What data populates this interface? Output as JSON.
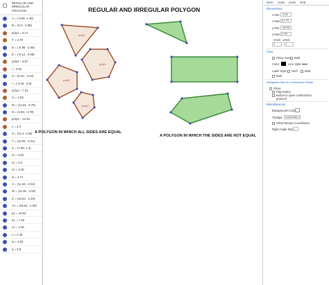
{
  "algebra": {
    "header": "REGULAR AND IRREGULAR POLYGON",
    "rows": [
      {
        "text": "A = (-3.96, 1.46)",
        "color": "#3c50b4"
      },
      {
        "text": "B = (0.4, -1.98)",
        "color": "#3c50b4"
      },
      {
        "text": "poly1 = 8.17",
        "color": "#b06030"
      },
      {
        "text": "F = 3.79",
        "color": "#b06030"
      },
      {
        "text": "D = (-0.98, -2.68)",
        "color": "#3c50b4"
      },
      {
        "text": "E = (-0.12, -2.98)",
        "color": "#3c50b4"
      },
      {
        "text": "poly2 = 8.87",
        "color": "#b06030"
      },
      {
        "text": "i = 2.82",
        "color": "#b06030"
      },
      {
        "text": "H = (0.32, -4.12)",
        "color": "#3c50b4"
      },
      {
        "text": "I = (-0.19, -5.5)",
        "color": "#3c50b4"
      },
      {
        "text": "poly3 = 7.51",
        "color": "#b06030"
      },
      {
        "text": "m = 2.06",
        "color": "#b06030"
      },
      {
        "text": "M = (11.94, -3.79)",
        "color": "#3c50b4"
      },
      {
        "text": "N = (4.08, -4.78)",
        "color": "#3c50b4"
      },
      {
        "text": "poly4 = 13.26",
        "color": "#b06030"
      },
      {
        "text": "s = 2.3",
        "color": "#b06030"
      },
      {
        "text": "S = (11.4, 1.86)",
        "color": "#3c50b4"
      },
      {
        "text": "T = (12.84, -0.44)",
        "color": "#3c50b4"
      },
      {
        "text": "U = (7.98, 1.4)",
        "color": "#3c50b4"
      },
      {
        "text": "t1 = 4.26",
        "color": "#3c50b4"
      },
      {
        "text": "s1 = 5.2",
        "color": "#3c50b4"
      },
      {
        "text": "v1 = 3.45",
        "color": "#3c50b4"
      },
      {
        "text": "w = 2.71",
        "color": "#3c50b4"
      },
      {
        "text": "V = (11.26, -2.04)",
        "color": "#3c50b4"
      },
      {
        "text": "W = (11.36, -4.52)",
        "color": "#3c50b4"
      },
      {
        "text": "Z = (18.54, -4.34)",
        "color": "#3c50b4"
      },
      {
        "text": "A1 = (18.54, -1.98)",
        "color": "#3c50b4"
      },
      {
        "text": "p1 = 19.64",
        "color": "#3c50b4"
      },
      {
        "text": "a1 = 7.26",
        "color": "#3c50b4"
      },
      {
        "text": "x1 = 2.36",
        "color": "#3c50b4"
      },
      {
        "text": "v = 2.48",
        "color": "#3c50b4"
      },
      {
        "text": "w = 2.82",
        "color": "#3c50b4"
      },
      {
        "text": "q = 5.8",
        "color": "#3c50b4"
      }
    ]
  },
  "graphics": {
    "title": "REGULAR AND IRREGULAR POLYGON",
    "caption_left": "A POLYGON IN WHICH ALL SIDES ARE EQUAL",
    "caption_right": "A POLYGON IN WHICH THE SIDES ARE NOT EQUAL",
    "polygon_labels": {
      "poly1": "poly1",
      "poly2": "poly2",
      "poly3": "poly3",
      "poly4": "poly4"
    },
    "colors": {
      "regular_fill": "#f5e6dc",
      "regular_stroke": "#a0522d",
      "irregular_fill": "#8fd17e",
      "irregular_stroke": "#3d8a3d",
      "point": "#3c50b4"
    }
  },
  "props": {
    "tabs": [
      "Basic",
      "xAxis",
      "yAxis",
      "Grid"
    ],
    "dimensions_title": "Dimensions",
    "xmin_label": "x Min:",
    "xmin": "-3.52",
    "xmax_label": "x Max:",
    "xmax": "21.79",
    "ymin_label": "y Min:",
    "ymin": "-28.06",
    "ymax_label": "y Max:",
    "ymax": "4.94",
    "ratio_label": "xAxis : yAxis",
    "ratio_left": "1",
    "ratio_right": "1",
    "axes_title": "Axes",
    "show_axes": "Show Axes",
    "bold": "Bold",
    "color_label": "Color:",
    "line_style_label": "Line Style:",
    "label_style_label": "Label Style:",
    "serif": "Serif",
    "bold2": "Bold",
    "italic": "Italic",
    "nav_title": "Navigation Bar for Construction Steps",
    "show": "Show",
    "play_button": "Play button",
    "open_protocol": "Button to open construction protocol",
    "misc_title": "Miscellaneous",
    "bg_color_label": "Background Color:",
    "tooltips_label": "Tooltips:",
    "tooltips_value": "Automatic",
    "show_mouse": "Show Mouse Coordinates",
    "right_angle_label": "Right Angle Style:"
  }
}
